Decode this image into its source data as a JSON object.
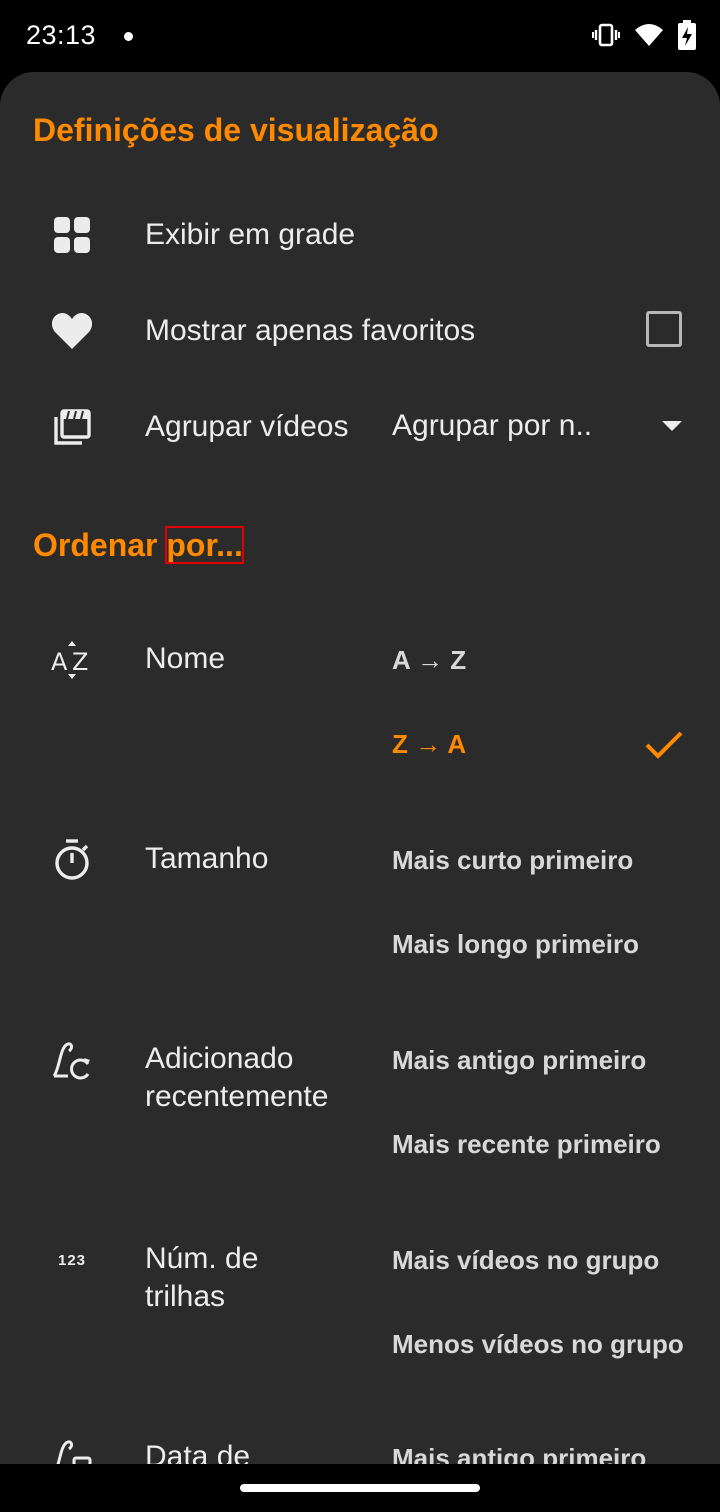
{
  "status_bar": {
    "time": "23:13",
    "icons": [
      "vibrate-icon",
      "wifi-icon",
      "battery-charging-icon"
    ]
  },
  "colors": {
    "accent": "#ff8a00",
    "sheet_background": "#2b2b2b",
    "text": "#ececec"
  },
  "display_settings": {
    "title": "Definições de visualização",
    "grid": {
      "label": "Exibir em grade",
      "icon": "grid-icon"
    },
    "favorites": {
      "label": "Mostrar apenas favoritos",
      "icon": "heart-icon",
      "checked": false
    },
    "group": {
      "label": "Agrupar vídeos",
      "icon": "video-library-icon",
      "value": "Agrupar por n.."
    }
  },
  "sort": {
    "title_main": "Ordenar ",
    "title_highlight": "por...",
    "items": [
      {
        "label": "Nome",
        "icon": "sort-az-icon",
        "options": [
          "A → Z",
          "Z → A"
        ],
        "selected": 1
      },
      {
        "label": "Tamanho",
        "icon": "timer-icon",
        "options": [
          "Mais curto primeiro",
          "Mais longo primeiro"
        ]
      },
      {
        "label": "Adicionado recentemente",
        "label_line1": "Adicionado",
        "label_line2": "recentemente",
        "icon": "recently-added-icon",
        "options": [
          "Mais antigo primeiro",
          "Mais recente primeiro"
        ]
      },
      {
        "label": "Núm. de trilhas",
        "label_line1": "Núm. de",
        "label_line2": "trilhas",
        "icon": "numbers-icon",
        "icon_text": "123",
        "options": [
          "Mais vídeos no grupo",
          "Menos vídeos no grupo"
        ]
      },
      {
        "label": "Data de",
        "icon": "date-icon",
        "options": [
          "Mais antigo primeiro"
        ]
      }
    ]
  }
}
